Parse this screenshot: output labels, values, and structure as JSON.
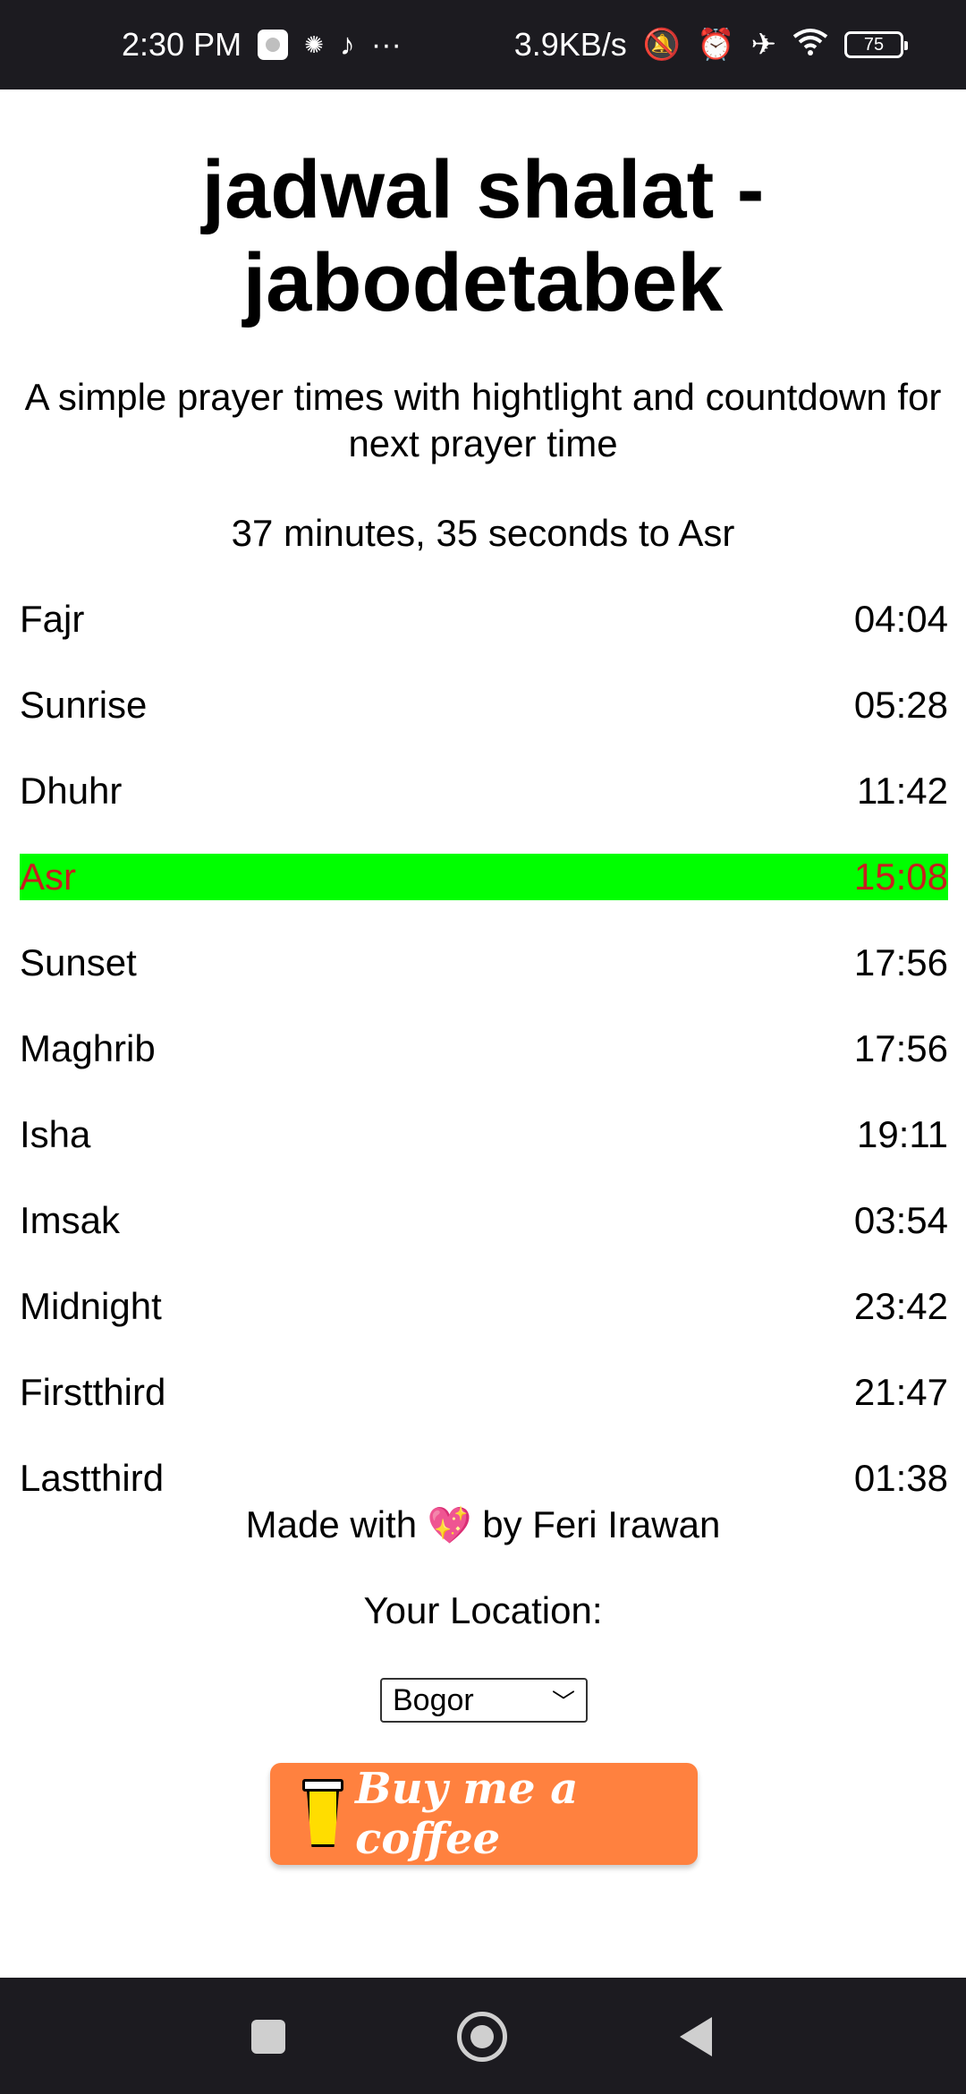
{
  "status_bar": {
    "time": "2:30 PM",
    "net_speed": "3.9KB/s",
    "battery": "75",
    "icons": [
      "gallery-icon",
      "bulb-icon",
      "tiktok-icon",
      "more-icon",
      "mute-icon",
      "alarm-icon",
      "airplane-icon",
      "wifi-icon",
      "battery-icon"
    ]
  },
  "page": {
    "title": "jadwal shalat - jabodetabek",
    "subtitle": "A simple prayer times with hightlight and countdown for next prayer time",
    "countdown": "37 minutes, 35 seconds to Asr"
  },
  "prayer_times": [
    {
      "name": "Fajr",
      "time": "04:04"
    },
    {
      "name": "Sunrise",
      "time": "05:28"
    },
    {
      "name": "Dhuhr",
      "time": "11:42"
    },
    {
      "name": "Asr",
      "time": "15:08"
    },
    {
      "name": "Sunset",
      "time": "17:56"
    },
    {
      "name": "Maghrib",
      "time": "17:56"
    },
    {
      "name": "Isha",
      "time": "19:11"
    },
    {
      "name": "Imsak",
      "time": "03:54"
    },
    {
      "name": "Midnight",
      "time": "23:42"
    },
    {
      "name": "Firstthird",
      "time": "21:47"
    },
    {
      "name": "Lastthird",
      "time": "01:38"
    }
  ],
  "highlight": {
    "active_prayer": "Asr",
    "bg_color": "#00ff00",
    "text_color": "#c81e1e"
  },
  "footer": {
    "made_with_prefix": "Made with",
    "heart": "💖",
    "made_with_suffix": "by Feri Irawan",
    "location_label": "Your Location:",
    "location_selected": "Bogor",
    "coffee_button_text": "Buy me a coffee",
    "coffee_color": "#ff813f"
  }
}
